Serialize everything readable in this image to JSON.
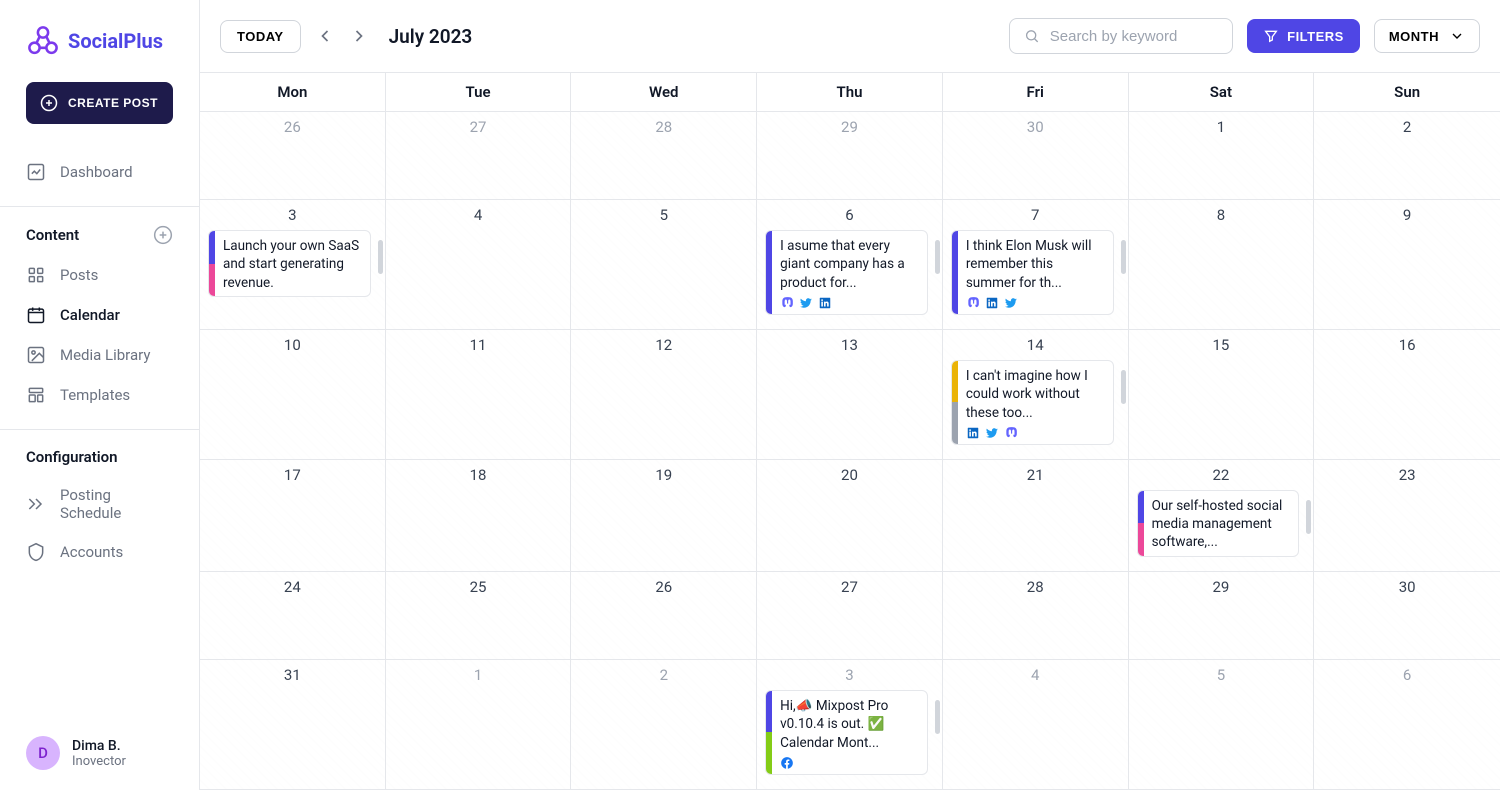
{
  "brand": "SocialPlus",
  "create_button": "CREATE POST",
  "nav": {
    "dashboard": "Dashboard",
    "content_header": "Content",
    "posts": "Posts",
    "calendar": "Calendar",
    "media": "Media Library",
    "templates": "Templates",
    "config_header": "Configuration",
    "schedule": "Posting Schedule",
    "accounts": "Accounts"
  },
  "user": {
    "initial": "D",
    "name": "Dima B.",
    "org": "Inovector"
  },
  "toolbar": {
    "today": "TODAY",
    "month_label": "July 2023",
    "search_placeholder": "Search by keyword",
    "filters": "FILTERS",
    "view": "MONTH"
  },
  "dow": [
    "Mon",
    "Tue",
    "Wed",
    "Thu",
    "Fri",
    "Sat",
    "Sun"
  ],
  "weeks": [
    [
      {
        "n": "26",
        "dim": true
      },
      {
        "n": "27",
        "dim": true
      },
      {
        "n": "28",
        "dim": true
      },
      {
        "n": "29",
        "dim": true
      },
      {
        "n": "30",
        "dim": true
      },
      {
        "n": "1"
      },
      {
        "n": "2"
      }
    ],
    [
      {
        "n": "3",
        "posts": [
          {
            "text": "Launch your own SaaS and start generating revenue.",
            "bars": [
              "#4f46e5",
              "#ec4899"
            ],
            "icons": []
          }
        ],
        "scroll": true
      },
      {
        "n": "4"
      },
      {
        "n": "5"
      },
      {
        "n": "6",
        "posts": [
          {
            "text": "I asume that every giant company has a product for...",
            "bars": [
              "#4f46e5"
            ],
            "icons": [
              "mastodon",
              "twitter",
              "linkedin"
            ]
          }
        ],
        "scroll": true
      },
      {
        "n": "7",
        "posts": [
          {
            "text": "I think Elon Musk will remember this summer for th...",
            "bars": [
              "#4f46e5"
            ],
            "icons": [
              "mastodon",
              "linkedin",
              "twitter"
            ]
          }
        ],
        "scroll": true
      },
      {
        "n": "8"
      },
      {
        "n": "9"
      }
    ],
    [
      {
        "n": "10"
      },
      {
        "n": "11"
      },
      {
        "n": "12"
      },
      {
        "n": "13"
      },
      {
        "n": "14",
        "posts": [
          {
            "text": "I can't imagine how I could work without these too...",
            "bars": [
              "#eab308",
              "#9ca3af"
            ],
            "icons": [
              "linkedin",
              "twitter",
              "mastodon"
            ]
          }
        ],
        "scroll": true
      },
      {
        "n": "15"
      },
      {
        "n": "16"
      }
    ],
    [
      {
        "n": "17"
      },
      {
        "n": "18"
      },
      {
        "n": "19"
      },
      {
        "n": "20"
      },
      {
        "n": "21"
      },
      {
        "n": "22",
        "posts": [
          {
            "text": "Our self-hosted social media management software,...",
            "bars": [
              "#4f46e5",
              "#ec4899"
            ],
            "icons": []
          }
        ],
        "scroll": true
      },
      {
        "n": "23"
      }
    ],
    [
      {
        "n": "24"
      },
      {
        "n": "25"
      },
      {
        "n": "26"
      },
      {
        "n": "27"
      },
      {
        "n": "28"
      },
      {
        "n": "29"
      },
      {
        "n": "30"
      }
    ],
    [
      {
        "n": "31"
      },
      {
        "n": "1",
        "dim": true
      },
      {
        "n": "2",
        "dim": true
      },
      {
        "n": "3",
        "dim": true,
        "posts": [
          {
            "text": "Hi,📣 Mixpost Pro v0.10.4 is out. ✅ Calendar Mont...",
            "bars": [
              "#4f46e5",
              "#84cc16"
            ],
            "icons": [
              "facebook"
            ]
          }
        ],
        "scroll": true
      },
      {
        "n": "4",
        "dim": true
      },
      {
        "n": "5",
        "dim": true
      },
      {
        "n": "6",
        "dim": true
      }
    ]
  ]
}
